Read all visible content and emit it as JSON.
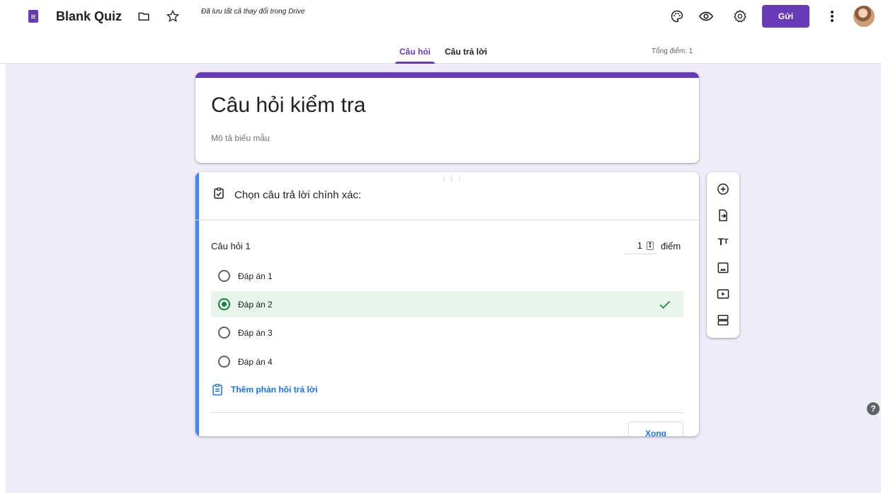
{
  "header": {
    "doc_title": "Blank Quiz",
    "save_status": "Đã lưu tất cả thay đổi trong Drive",
    "send_label": "Gửi",
    "icons": [
      "folder-icon",
      "star-icon",
      "palette-icon",
      "preview-icon",
      "settings-icon",
      "more-vert-icon"
    ]
  },
  "tabs": [
    {
      "label": "Câu hỏi",
      "active": true
    },
    {
      "label": "Câu trả lời",
      "active": false
    }
  ],
  "total_points": "Tổng điểm: 1",
  "form": {
    "title": "Câu hỏi kiểm tra",
    "description_placeholder": "Mô tả biểu mẫu"
  },
  "question": {
    "answer_key_label": "Chọn câu trả lời chính xác:",
    "label": "Câu hỏi 1",
    "points_value": "1",
    "points_unit": "điểm",
    "options": [
      {
        "label": "Đáp án 1",
        "correct": false
      },
      {
        "label": "Đáp án 2",
        "correct": true
      },
      {
        "label": "Đáp án 3",
        "correct": false
      },
      {
        "label": "Đáp án 4",
        "correct": false
      }
    ],
    "feedback_link": "Thêm phản hồi trả lời",
    "done_label": "Xong"
  },
  "toolbar": [
    "add-question-icon",
    "import-questions-icon",
    "add-title-icon",
    "add-image-icon",
    "add-video-icon",
    "add-section-icon"
  ],
  "colors": {
    "accent": "#673ab7",
    "background": "#f0ebf8",
    "correct_bg": "#e6f4ea",
    "correct": "#188038",
    "link": "#1a73e8",
    "active_card_bar": "#4285f4"
  }
}
